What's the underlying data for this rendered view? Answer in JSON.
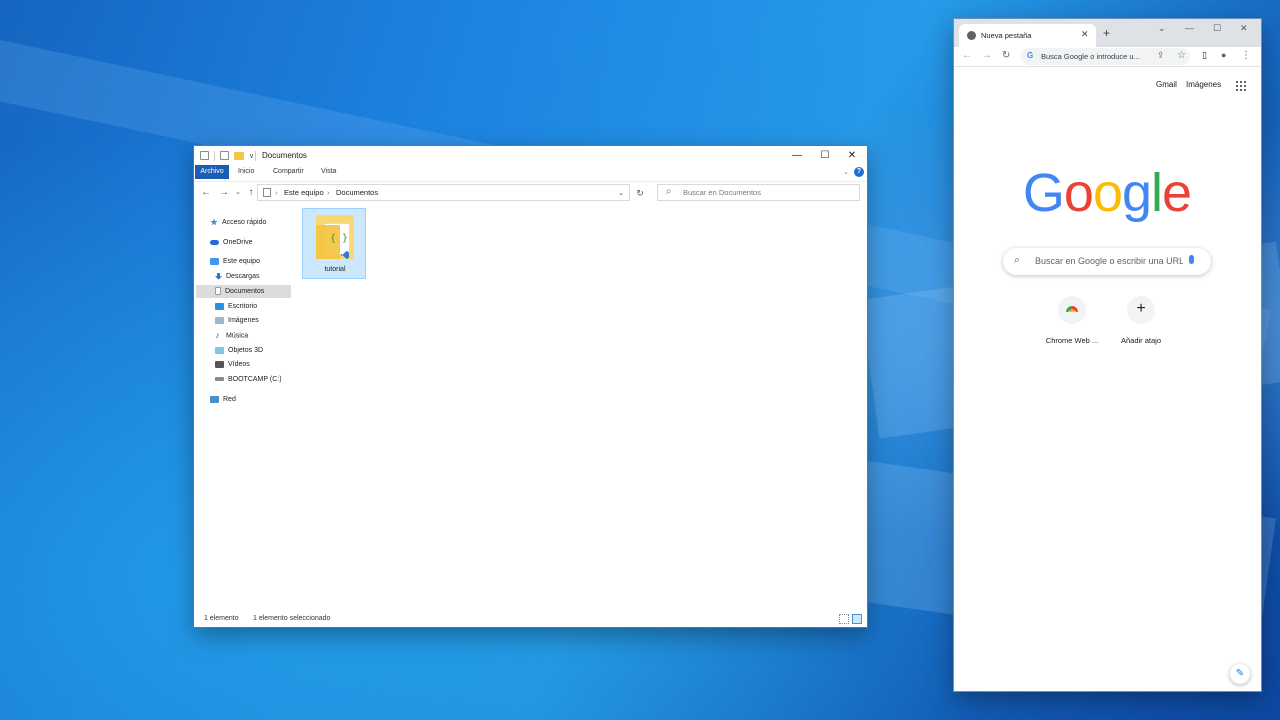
{
  "explorer": {
    "title": "Documentos",
    "qa_dropdown": "∨",
    "window_controls": {
      "minimize": "—",
      "maximize": "☐",
      "close": "✕"
    },
    "ribbon": {
      "file": "Archivo",
      "tabs": [
        "Inicio",
        "Compartir",
        "Vista"
      ],
      "help": "?"
    },
    "address": {
      "back": "←",
      "forward": "→",
      "recent": "⌄",
      "up": "↑",
      "crumbs": [
        "Este equipo",
        "Documentos"
      ],
      "separator": "›",
      "dropdown": "⌄",
      "refresh": "↻"
    },
    "search": {
      "placeholder": "Buscar en Documentos",
      "icon": "⌕"
    },
    "nav": {
      "quick_access": "Acceso rápido",
      "onedrive": "OneDrive",
      "this_pc": "Este equipo",
      "downloads": "Descargas",
      "documents": "Documentos",
      "desktop": "Escritorio",
      "pictures": "Imágenes",
      "music": "Música",
      "objects3d": "Objetos 3D",
      "videos": "Vídeos",
      "drive_c": "BOOTCAMP (C:)",
      "network": "Red"
    },
    "files": [
      {
        "name": "tutorial",
        "icon": "vscode-workspace-folder",
        "braces": "{ }"
      }
    ],
    "status": {
      "count": "1 elemento",
      "selected": "1 elemento seleccionado"
    }
  },
  "chrome": {
    "tab": {
      "title": "Nueva pestaña",
      "close": "✕"
    },
    "newtab": "+",
    "window_controls": {
      "chevron": "⌄",
      "minimize": "—",
      "maximize": "☐",
      "close": "✕"
    },
    "toolbar": {
      "back": "←",
      "forward": "→",
      "reload": "↻",
      "omnibox_g": "G",
      "omnibox_text": "Busca Google o introduce u...",
      "share": "⇪",
      "star": "☆",
      "sidepanel": "▯",
      "profile": "●",
      "menu": "⋮"
    },
    "links": {
      "gmail": "Gmail",
      "images": "Imágenes"
    },
    "logo": [
      "G",
      "o",
      "o",
      "g",
      "l",
      "e"
    ],
    "logo_colors": [
      "#4285f4",
      "#ea4335",
      "#fbbc05",
      "#4285f4",
      "#34a853",
      "#ea4335"
    ],
    "search": {
      "placeholder": "Buscar en Google o escribir una URL",
      "icon": "⌕"
    },
    "shortcuts": [
      {
        "label": "Chrome Web ...",
        "icon": "chrome-web-store-icon"
      },
      {
        "label": "Añadir atajo",
        "icon": "+"
      }
    ],
    "customize": "✎"
  }
}
